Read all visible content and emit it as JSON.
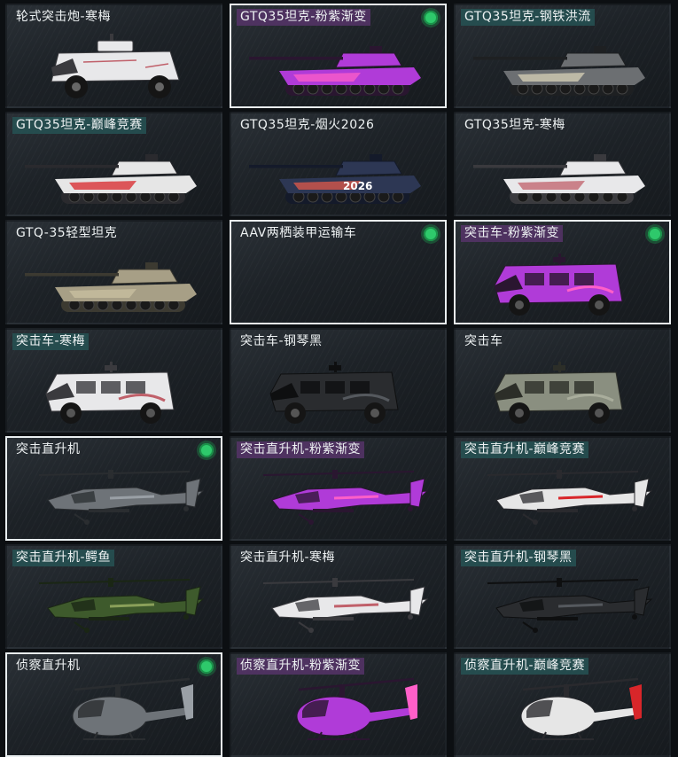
{
  "colors": {
    "selected_border": "#e9eef0",
    "status_dot": "#2ec96b",
    "label_bg_teal": "#265254",
    "label_bg_purple": "#563468"
  },
  "items": [
    {
      "label": "轮式突击炮-寒梅",
      "vehicle": "wheeled-gun",
      "skin": "plum",
      "tint": "none",
      "selected": false,
      "badge": false
    },
    {
      "label": "GTQ35坦克-粉紫渐变",
      "vehicle": "tank",
      "skin": "pink-purple",
      "tint": "purple",
      "selected": true,
      "badge": true
    },
    {
      "label": "GTQ35坦克-钢铁洪流",
      "vehicle": "tank",
      "skin": "steel",
      "tint": "teal",
      "selected": false,
      "badge": false
    },
    {
      "label": "GTQ35坦克-巅峰竞赛",
      "vehicle": "tank",
      "skin": "race",
      "tint": "teal",
      "selected": false,
      "badge": false
    },
    {
      "label": "GTQ35坦克-烟火2026",
      "vehicle": "tank",
      "skin": "fireworks",
      "tint": "none",
      "selected": false,
      "badge": false
    },
    {
      "label": "GTQ35坦克-寒梅",
      "vehicle": "tank",
      "skin": "plum",
      "tint": "none",
      "selected": false,
      "badge": false
    },
    {
      "label": "GTQ-35轻型坦克",
      "vehicle": "tank",
      "skin": "desert",
      "tint": "none",
      "selected": false,
      "badge": false
    },
    {
      "label": "AAV两栖装甲运输车",
      "vehicle": "none",
      "skin": "none",
      "tint": "none",
      "selected": true,
      "badge": true
    },
    {
      "label": "突击车-粉紫渐变",
      "vehicle": "truck",
      "skin": "pink-purple",
      "tint": "purple",
      "selected": true,
      "badge": true
    },
    {
      "label": "突击车-寒梅",
      "vehicle": "truck",
      "skin": "plum",
      "tint": "teal",
      "selected": false,
      "badge": false
    },
    {
      "label": "突击车-钢琴黑",
      "vehicle": "truck",
      "skin": "black",
      "tint": "none",
      "selected": false,
      "badge": false
    },
    {
      "label": "突击车",
      "vehicle": "truck",
      "skin": "olive",
      "tint": "none",
      "selected": false,
      "badge": false
    },
    {
      "label": "突击直升机",
      "vehicle": "attack-heli",
      "skin": "grey",
      "tint": "none",
      "selected": true,
      "badge": true
    },
    {
      "label": "突击直升机-粉紫渐变",
      "vehicle": "attack-heli",
      "skin": "pink-purple",
      "tint": "purple",
      "selected": false,
      "badge": false
    },
    {
      "label": "突击直升机-巅峰竞赛",
      "vehicle": "attack-heli",
      "skin": "race",
      "tint": "teal",
      "selected": false,
      "badge": false
    },
    {
      "label": "突击直升机-鳄鱼",
      "vehicle": "attack-heli",
      "skin": "croc",
      "tint": "teal",
      "selected": false,
      "badge": false
    },
    {
      "label": "突击直升机-寒梅",
      "vehicle": "attack-heli",
      "skin": "plum",
      "tint": "none",
      "selected": false,
      "badge": false
    },
    {
      "label": "突击直升机-钢琴黑",
      "vehicle": "attack-heli",
      "skin": "black",
      "tint": "teal",
      "selected": false,
      "badge": false
    },
    {
      "label": "侦察直升机",
      "vehicle": "scout-heli",
      "skin": "grey",
      "tint": "none",
      "selected": true,
      "badge": true
    },
    {
      "label": "侦察直升机-粉紫渐变",
      "vehicle": "scout-heli",
      "skin": "pink-purple",
      "tint": "purple",
      "selected": false,
      "badge": false
    },
    {
      "label": "侦察直升机-巅峰竞赛",
      "vehicle": "scout-heli",
      "skin": "race",
      "tint": "teal",
      "selected": false,
      "badge": false
    }
  ],
  "tank_plate_text": "2026"
}
